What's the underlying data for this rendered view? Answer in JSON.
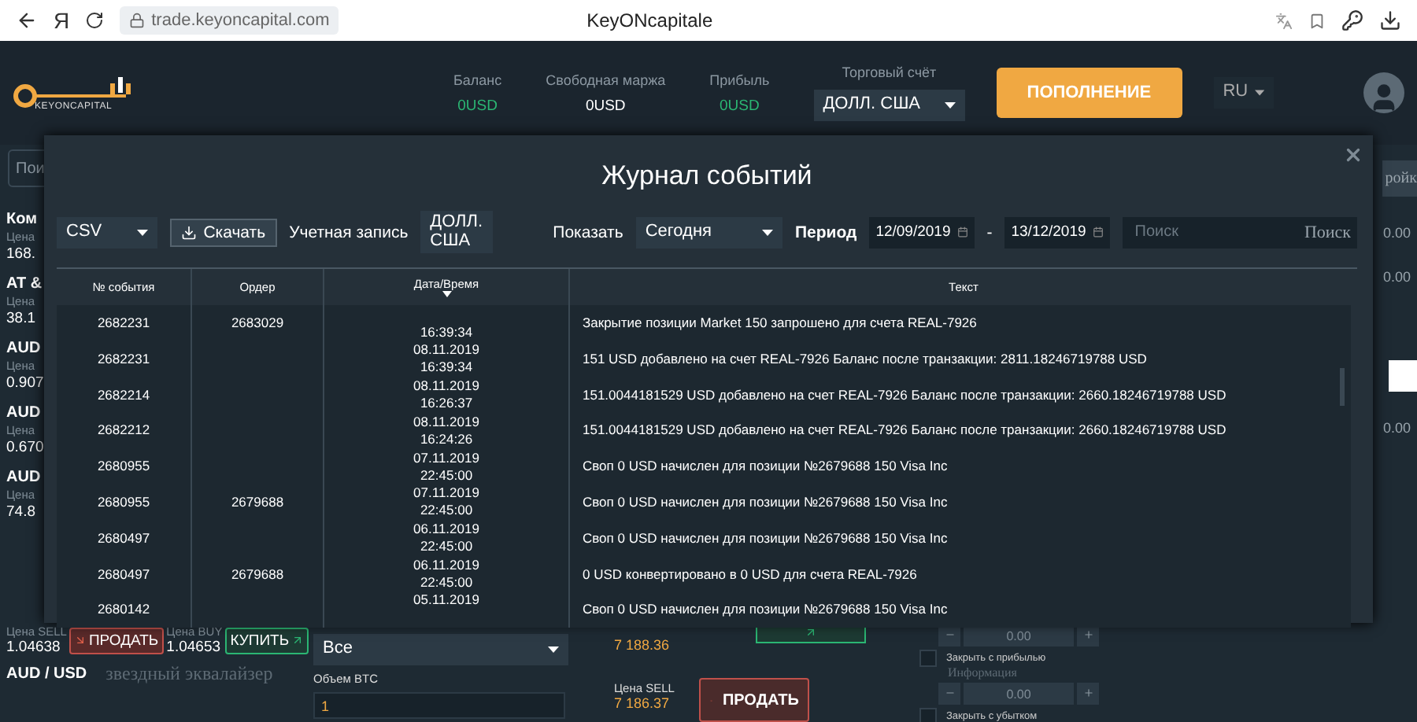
{
  "browser": {
    "brand_letter": "Я",
    "url": "trade.keyoncapital.com",
    "title": "KeyONcapitale"
  },
  "header": {
    "logo_text": "KEYONCAPITAL",
    "stats": [
      {
        "label": "Баланс",
        "value": "0USD",
        "color": "#2bb673"
      },
      {
        "label": "Свободная маржа",
        "value": "0USD",
        "color": "#ffffff"
      },
      {
        "label": "Прибыль",
        "value": "0USD",
        "color": "#2bb673"
      }
    ],
    "account": {
      "label": "Торговый счёт",
      "value": "ДОЛЛ. США"
    },
    "deposit_button": "ПОПОЛНЕНИЕ",
    "language": "RU"
  },
  "sidebar": {
    "search_placeholder": "Пои",
    "items": [
      {
        "name": "Ком",
        "label": "Цена",
        "price": "168."
      },
      {
        "name": "AT &",
        "label": "Цена",
        "price": "38.1"
      },
      {
        "name": "AUD",
        "label": "Цена",
        "price": "0.907"
      },
      {
        "name": "AUD",
        "label": "Цена",
        "price": "0.670"
      },
      {
        "name": "AUD",
        "label": "Цена",
        "price": "74.8"
      }
    ],
    "quote": {
      "sell_label": "Цена SELL",
      "sell_price": "1.04638",
      "sell_button": "ПРОДАТЬ",
      "buy_label": "Цена BUY",
      "buy_price": "1.04653",
      "buy_button": "КУПИТЬ"
    },
    "next_name": "AUD / USD",
    "overlay_text": "звездный эквалайзер"
  },
  "order_form": {
    "type_value": "Все",
    "volume_label": "Объем BTC",
    "volume_value": "1"
  },
  "price_panel": {
    "buy_price": "7 188.36",
    "sell_label": "Цена SELL",
    "sell_price": "7 186.37",
    "sell_button": "ПРОДАТЬ"
  },
  "protection": {
    "take_profit_value": "0.00",
    "take_profit_checked": false,
    "take_profit_label": "Закрыть с прибылью",
    "info": "Информация",
    "stop_loss_value": "0.00",
    "stop_loss_checked": false,
    "stop_loss_label": "Закрыть с убытком"
  },
  "right_strip": {
    "button": "ройк",
    "values": [
      "0.00",
      "0.00",
      "0.00"
    ]
  },
  "modal": {
    "title": "Журнал событий",
    "format": "CSV",
    "download_button": "Скачать",
    "account_label": "Учетная запись",
    "account_value": "ДОЛЛ. США",
    "show_label": "Показать",
    "show_value": "Сегодня",
    "period_label": "Период",
    "date_from": "12/09/2019",
    "date_separator": "-",
    "date_to": "13/12/2019",
    "search_placeholder": "Поиск",
    "search_button": "Поиск",
    "columns": [
      {
        "label": "№ события",
        "sorted": false
      },
      {
        "label": "Ордер",
        "sorted": false
      },
      {
        "label": "Дата/Время",
        "sorted": true
      },
      {
        "label": "Текст",
        "sorted": false
      }
    ],
    "rows": [
      {
        "event": "2682231",
        "order": "2683029",
        "time": "16:39:34",
        "text": "Закрытие позиции Market 150 запрошено для счета REAL-7926"
      },
      {
        "event": "2682231",
        "date": "08.11.2019",
        "time": "16:39:34",
        "text": "151 USD добавлено на счет REAL-7926 Баланс после транзакции: 2811.18246719788 USD"
      },
      {
        "event": "2682214",
        "date": "08.11.2019",
        "time": "16:26:37",
        "text": "151.0044181529 USD добавлено на счет REAL-7926 Баланс после транзакции: 2660.18246719788 USD"
      },
      {
        "event": "2682212",
        "date": "08.11.2019",
        "time": "16:24:26",
        "text": "151.0044181529 USD добавлено на счет REAL-7926 Баланс после транзакции: 2660.18246719788 USD"
      },
      {
        "event": "2680955",
        "date": "07.11.2019",
        "time": "22:45:00",
        "text": "Своп 0 USD начислен для позиции №2679688 150 Visa Inc"
      },
      {
        "event": "2680955",
        "order": "2679688",
        "date": "07.11.2019",
        "time": "22:45:00",
        "text": "Своп 0 USD начислен для позиции №2679688 150 Visa Inc"
      },
      {
        "event": "2680497",
        "date": "06.11.2019",
        "time": "22:45:00",
        "text": "Своп 0 USD начислен для позиции №2679688 150 Visa Inc"
      },
      {
        "event": "2680497",
        "order": "2679688",
        "date": "06.11.2019",
        "time": "22:45:00",
        "text": "0 USD конвертировано в 0 USD для счета REAL-7926"
      },
      {
        "event": "2680142",
        "date": "05.11.2019",
        "text": "Своп 0 USD начислен для позиции №2679688 150 Visa Inc"
      }
    ]
  }
}
